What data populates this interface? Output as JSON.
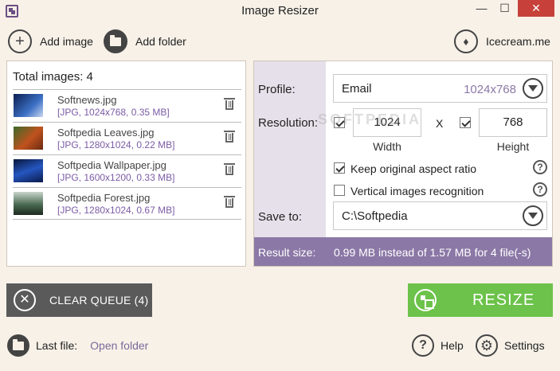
{
  "window": {
    "title": "Image Resizer",
    "minimize": "—",
    "maximize": "☐",
    "close": "✕"
  },
  "toolbar": {
    "add_image": "Add image",
    "add_folder": "Add folder",
    "site": "Icecream.me"
  },
  "files": {
    "total_label": "Total images: 4",
    "items": [
      {
        "name": "Softnews.jpg",
        "meta": "[JPG, 1024x768, 0.35 MB]",
        "thumb_color": "#1a3a7a"
      },
      {
        "name": "Softpedia Leaves.jpg",
        "meta": "[JPG, 1280x1024, 0.22 MB]",
        "thumb_color": "#8a3a1a"
      },
      {
        "name": "Softpedia Wallpaper.jpg",
        "meta": "[JPG, 1600x1200, 0.33 MB]",
        "thumb_color": "#1d3f8c"
      },
      {
        "name": "Softpedia Forest.jpg",
        "meta": "[JPG, 1280x1024, 0.67 MB]",
        "thumb_color": "#2f4a3a"
      }
    ]
  },
  "settings": {
    "profile_label": "Profile:",
    "profile_value": "Email",
    "profile_hint": "1024x768",
    "resolution_label": "Resolution:",
    "width_value": "1024",
    "height_value": "768",
    "separator": "X",
    "width_label": "Width",
    "height_label": "Height",
    "keep_aspect": "Keep original aspect ratio",
    "vertical_recognition": "Vertical images recognition",
    "help_glyph": "?",
    "save_label": "Save to:",
    "save_value": "C:\\Softpedia",
    "result_label": "Result size:",
    "result_value": "0.99 MB instead of 1.57 MB for 4 file(-s)",
    "watermark": "SOFTPEDIA"
  },
  "actions": {
    "clear_queue": "CLEAR QUEUE (4)",
    "resize": "RESIZE"
  },
  "footer": {
    "last_file": "Last file:",
    "open_folder": "Open folder",
    "help": "Help",
    "settings": "Settings"
  },
  "colors": {
    "accent_purple": "#8b78a6",
    "resize_green": "#6cc24a",
    "clear_gray": "#5a5a5a",
    "close_red": "#c7413a"
  }
}
